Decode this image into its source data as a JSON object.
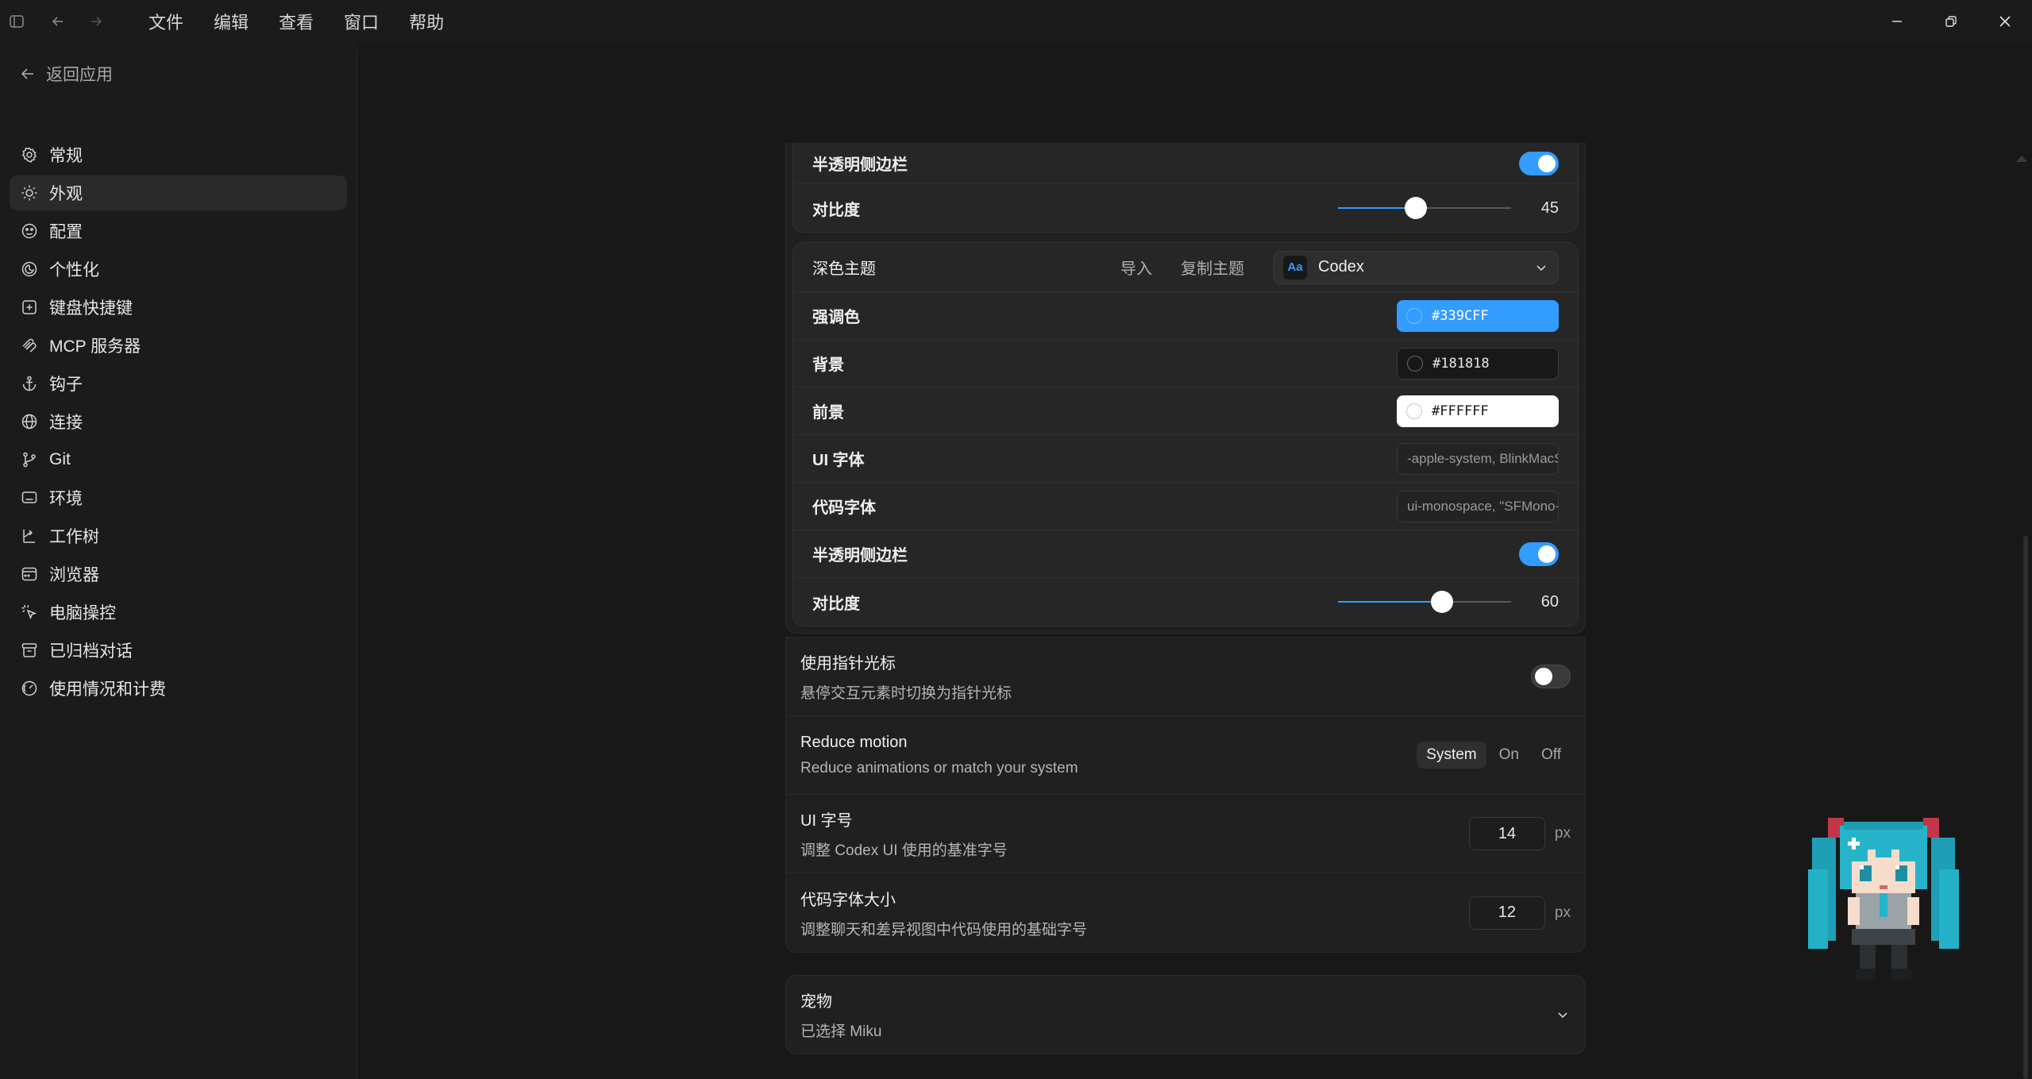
{
  "titlebar": {
    "menus": [
      "文件",
      "编辑",
      "查看",
      "窗口",
      "帮助"
    ]
  },
  "sidebar": {
    "back_label": "返回应用",
    "items": [
      {
        "label": "常规",
        "icon": "gear-icon"
      },
      {
        "label": "外观",
        "icon": "sun-icon",
        "active": true
      },
      {
        "label": "配置",
        "icon": "config-icon"
      },
      {
        "label": "个性化",
        "icon": "personalize-icon"
      },
      {
        "label": "键盘快捷键",
        "icon": "keyboard-icon"
      },
      {
        "label": "MCP 服务器",
        "icon": "mcp-icon"
      },
      {
        "label": "钩子",
        "icon": "anchor-icon"
      },
      {
        "label": "连接",
        "icon": "globe-icon"
      },
      {
        "label": "Git",
        "icon": "git-branch-icon"
      },
      {
        "label": "环境",
        "icon": "monitor-icon"
      },
      {
        "label": "工作树",
        "icon": "worktree-icon"
      },
      {
        "label": "浏览器",
        "icon": "browser-icon"
      },
      {
        "label": "电脑操控",
        "icon": "cursor-click-icon"
      },
      {
        "label": "已归档对话",
        "icon": "archive-icon"
      },
      {
        "label": "使用情况和计费",
        "icon": "gauge-icon"
      }
    ]
  },
  "light_section": {
    "translucent_sidebar_label": "半透明侧边栏",
    "translucent_sidebar_on": true,
    "contrast_label": "对比度",
    "contrast_value": "45",
    "contrast_fraction": 0.45
  },
  "dark_theme": {
    "label": "深色主题",
    "import_label": "导入",
    "copy_label": "复制主题",
    "theme_badge": "Aa",
    "theme_name": "Codex",
    "accent_label": "强调色",
    "accent_value": "#339CFF",
    "background_label": "背景",
    "background_value": "#181818",
    "foreground_label": "前景",
    "foreground_value": "#FFFFFF",
    "ui_font_label": "UI 字体",
    "ui_font_value": "-apple-system, BlinkMacSystemFont",
    "code_font_label": "代码字体",
    "code_font_value": "ui-monospace, \"SFMono-Regular\"",
    "translucent_sidebar_label": "半透明侧边栏",
    "translucent_sidebar_on": true,
    "contrast_label": "对比度",
    "contrast_value": "60",
    "contrast_fraction": 0.6
  },
  "pointer_cursor": {
    "title": "使用指针光标",
    "desc": "悬停交互元素时切换为指针光标",
    "on": false
  },
  "reduce_motion": {
    "title": "Reduce motion",
    "desc": "Reduce animations or match your system",
    "options": [
      "System",
      "On",
      "Off"
    ],
    "selected": "System"
  },
  "ui_font_size": {
    "title": "UI 字号",
    "desc": "调整 Codex UI 使用的基准字号",
    "value": "14",
    "unit": "px"
  },
  "code_font_size": {
    "title": "代码字体大小",
    "desc": "调整聊天和差异视图中代码使用的基础字号",
    "value": "12",
    "unit": "px"
  },
  "pet": {
    "title": "宠物",
    "desc": "已选择 Miku"
  },
  "colors": {
    "accent": "#339cff",
    "bg": "#181818",
    "sidebar_bg": "#1b1b1b"
  }
}
